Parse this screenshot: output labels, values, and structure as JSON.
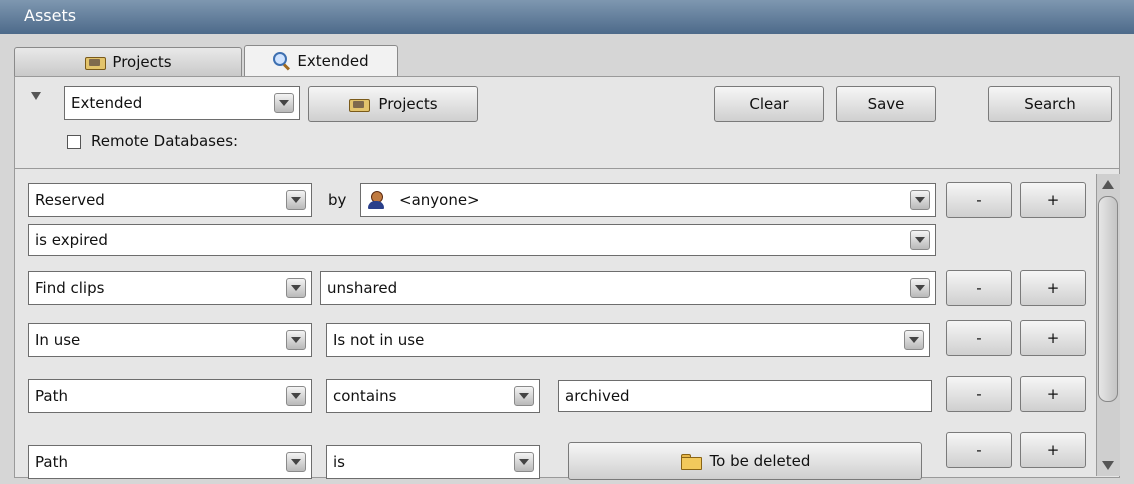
{
  "window": {
    "title": "Assets"
  },
  "tabs": [
    {
      "label": "Projects",
      "icon": "projects-icon",
      "active": false
    },
    {
      "label": "Extended",
      "icon": "search-icon",
      "active": true
    }
  ],
  "toolbar": {
    "mode_select": "Extended",
    "projects_button": "Projects",
    "clear_button": "Clear",
    "save_button": "Save",
    "search_button": "Search",
    "remote_databases_label": "Remote Databases:",
    "remote_databases_checked": false
  },
  "criteria": [
    {
      "field": "Reserved",
      "connector": "by",
      "value": "<anyone>",
      "value_icon": "user-icon",
      "sub": "is expired"
    },
    {
      "field": "Find clips",
      "value": "unshared"
    },
    {
      "field": "In use",
      "value": "Is not in use"
    },
    {
      "field": "Path",
      "operator": "contains",
      "value": "archived"
    },
    {
      "field": "Path",
      "operator": "is",
      "value": "To be deleted",
      "value_icon": "folder-icon"
    }
  ],
  "row_buttons": {
    "remove": "-",
    "add": "+"
  }
}
